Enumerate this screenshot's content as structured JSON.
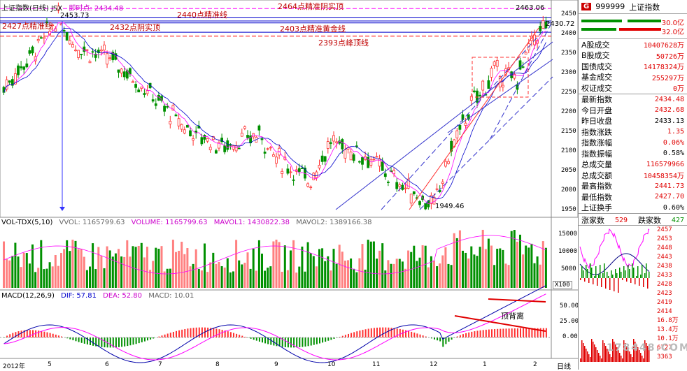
{
  "main": {
    "title": "上证指数(日线) JSX",
    "instant_label": "即时点: 2434.48",
    "price_ticks": [
      "2450",
      "2400",
      "2350",
      "2300",
      "2250",
      "2200",
      "2150",
      "2100",
      "2050",
      "2000",
      "1950"
    ],
    "high_marker": "2453.73",
    "low_marker": "1949.46",
    "last_high_marker": "2463.06",
    "last_close_marker": "2430.72",
    "annotations": [
      "2464点精准阴实顶",
      "2440点精准线",
      "2427点精准线",
      "2432点阴实顶",
      "2403点精准黄金线",
      "2393点峰顶线"
    ]
  },
  "volume": {
    "header": [
      "VOL-TDX(5,10)",
      "VVOL: 1165799.63",
      "VOLUME: 1165799.63",
      "MAVOL1: 1430822.38",
      "MAVOL2: 1389166.38"
    ],
    "ticks": [
      "15000",
      "10000",
      "5000"
    ],
    "unit": "X100"
  },
  "macd": {
    "header": [
      "MACD(12,26,9)",
      "DIF: 57.81",
      "DEA: 52.80",
      "MACD: 10.01"
    ],
    "ticks": [
      "50.00",
      "25.00",
      "0.00"
    ],
    "divergence_label": "顶背离"
  },
  "dates": [
    "2012年",
    "5",
    "6",
    "7",
    "8",
    "9",
    "10",
    "11",
    "12",
    "1",
    "2"
  ],
  "period_label": "日线",
  "info": {
    "code_badge": "G",
    "code": "999999",
    "name": "上证指数",
    "bar_top": "30.0亿",
    "bar_bottom": "32.0亿",
    "rows1": [
      {
        "k": "A股成交",
        "v": "10407628万"
      },
      {
        "k": "B股成交",
        "v": "50726万"
      },
      {
        "k": "国债成交",
        "v": "14178324万"
      },
      {
        "k": "基金成交",
        "v": "255297万"
      },
      {
        "k": "权证成交",
        "v": "0万"
      }
    ],
    "rows2": [
      {
        "k": "最新指数",
        "v": "2434.48",
        "c": "red"
      },
      {
        "k": "今日开盘",
        "v": "2432.68",
        "c": "red"
      },
      {
        "k": "昨日收盘",
        "v": "2433.13",
        "c": "black"
      },
      {
        "k": "指数涨跌",
        "v": "1.35",
        "c": "red"
      },
      {
        "k": "指数涨幅",
        "v": "0.06%",
        "c": "red"
      },
      {
        "k": "指数振幅",
        "v": "0.58%",
        "c": "black"
      },
      {
        "k": "总成交量",
        "v": "116579966",
        "c": "red"
      },
      {
        "k": "总成交额",
        "v": "10458354万",
        "c": "red"
      },
      {
        "k": "最高指数",
        "v": "2441.73",
        "c": "red"
      },
      {
        "k": "最低指数",
        "v": "2427.70",
        "c": "red"
      },
      {
        "k": "上证换手",
        "v": "0.60%",
        "c": "black"
      }
    ],
    "updown": {
      "up_label": "涨家数",
      "up": "529",
      "down_label": "跌家数",
      "down": "427"
    },
    "mini_ticks": [
      "2457",
      "2453",
      "2448",
      "2443",
      "2438",
      "2433",
      "2428",
      "2423",
      "2419",
      "2414",
      "16.8万",
      "13.4万",
      "10.1万",
      "6727",
      "3363"
    ],
    "watermark": "178448.COM"
  },
  "colors": {
    "up": "#ff3030",
    "down": "#009000",
    "ma1": "#ff00ff",
    "ma2": "#0000cc",
    "grid": "#b0b0ff"
  }
}
